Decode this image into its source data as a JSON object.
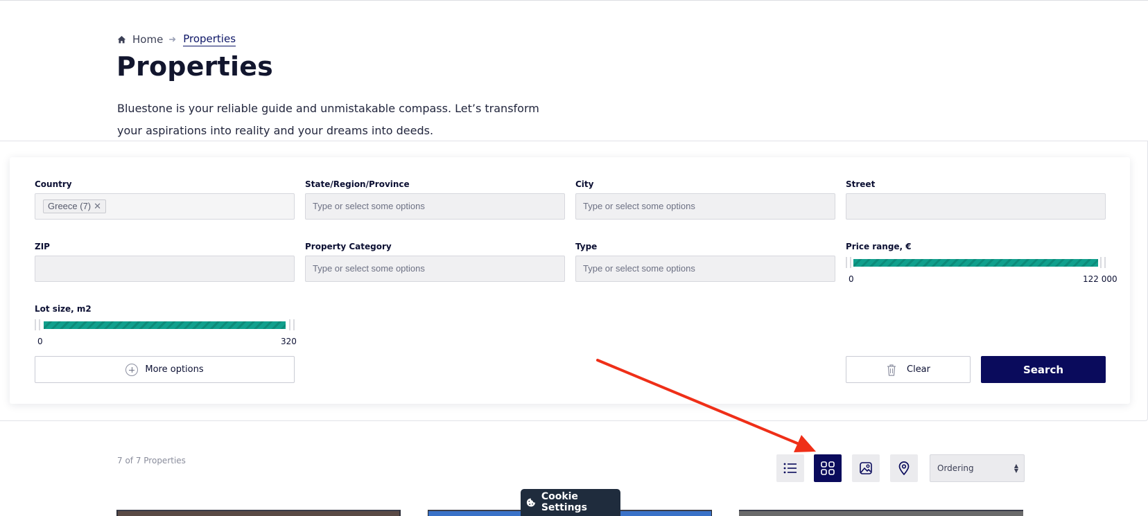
{
  "breadcrumb": {
    "home": "Home",
    "current": "Properties"
  },
  "page": {
    "title": "Properties",
    "description": "Bluestone is your reliable guide and unmistakable compass. Let’s transform your aspirations into reality and your dreams into deeds."
  },
  "filters": {
    "country": {
      "label": "Country",
      "selected_tag": "Greece (7)",
      "remove_glyph": "✕"
    },
    "state": {
      "label": "State/Region/Province",
      "placeholder": "Type or select some options"
    },
    "city": {
      "label": "City",
      "placeholder": "Type or select some options"
    },
    "street": {
      "label": "Street",
      "value": ""
    },
    "zip": {
      "label": "ZIP",
      "value": ""
    },
    "category": {
      "label": "Property Category",
      "placeholder": "Type or select some options"
    },
    "type": {
      "label": "Type",
      "placeholder": "Type or select some options"
    },
    "price": {
      "label": "Price range, €",
      "min": "0",
      "max": "122 000",
      "selected_min": 0,
      "selected_max": 122000
    },
    "lot": {
      "label": "Lot size, m2",
      "min": "0",
      "max": "320",
      "selected_min": 0,
      "selected_max": 320
    },
    "more_options_label": "More options",
    "clear_label": "Clear",
    "search_label": "Search"
  },
  "results": {
    "count_text": "7 of 7 Properties",
    "view_modes": [
      {
        "name": "list-view",
        "icon": "list-icon",
        "active": false
      },
      {
        "name": "grid-view",
        "icon": "grid-icon",
        "active": true
      },
      {
        "name": "gallery-view",
        "icon": "image-icon",
        "active": false
      },
      {
        "name": "map-view",
        "icon": "map-pin-icon",
        "active": false
      }
    ],
    "ordering": {
      "selected": "Ordering"
    }
  },
  "cookie": {
    "label": "Cookie Settings"
  },
  "colors": {
    "primary": "#0a0b5c",
    "slider": "#10a08d",
    "annotation_arrow": "#ef2f18",
    "cookie_bg": "#1f2c3d"
  }
}
